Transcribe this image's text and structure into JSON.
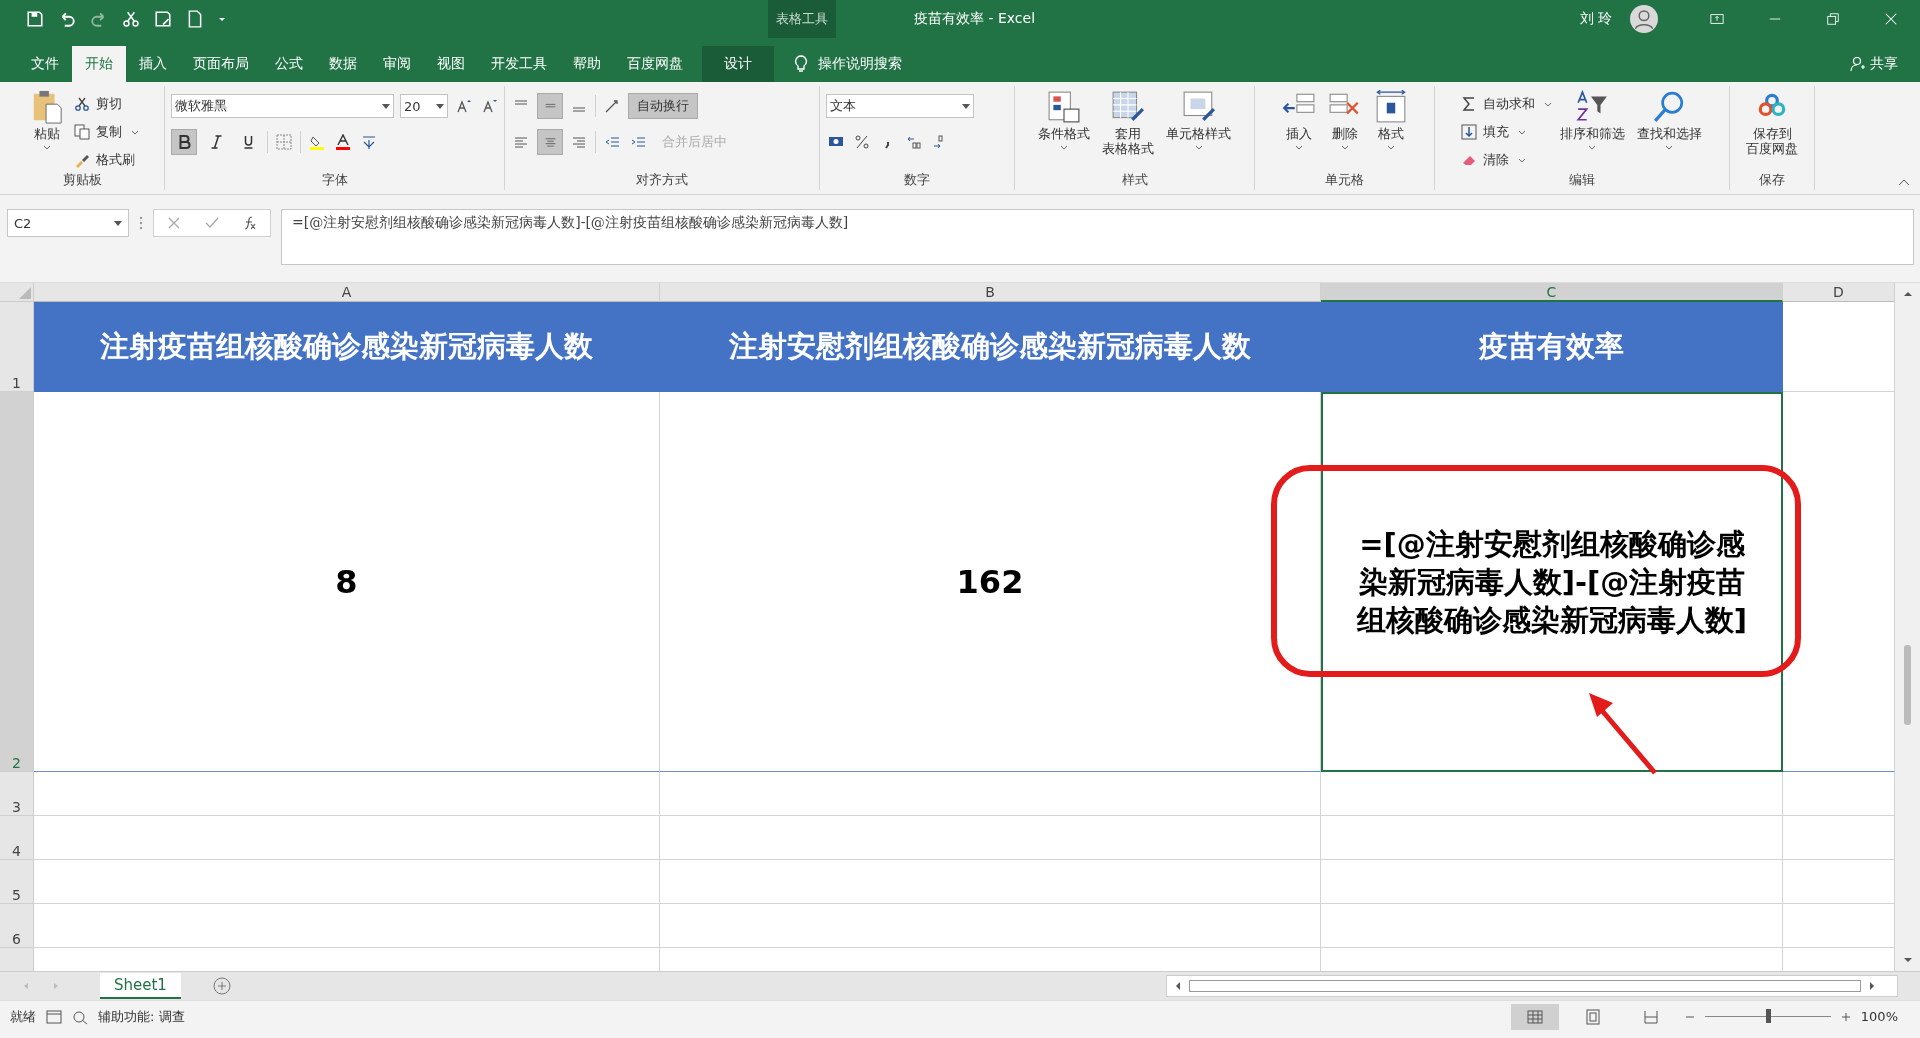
{
  "window": {
    "context_label": "表格工具",
    "title": "疫苗有效率 - Excel",
    "user": "刘 玲"
  },
  "tabs": [
    {
      "label": "文件",
      "selected": false,
      "kind": "normal"
    },
    {
      "label": "开始",
      "selected": true,
      "kind": "normal"
    },
    {
      "label": "插入",
      "selected": false,
      "kind": "normal"
    },
    {
      "label": "页面布局",
      "selected": false,
      "kind": "normal"
    },
    {
      "label": "公式",
      "selected": false,
      "kind": "normal"
    },
    {
      "label": "数据",
      "selected": false,
      "kind": "normal"
    },
    {
      "label": "审阅",
      "selected": false,
      "kind": "normal"
    },
    {
      "label": "视图",
      "selected": false,
      "kind": "normal"
    },
    {
      "label": "开发工具",
      "selected": false,
      "kind": "normal"
    },
    {
      "label": "帮助",
      "selected": false,
      "kind": "normal"
    },
    {
      "label": "百度网盘",
      "selected": false,
      "kind": "normal"
    },
    {
      "label": "设计",
      "selected": false,
      "kind": "contextual"
    }
  ],
  "tell_me": "操作说明搜索",
  "share": "共享",
  "clipboard": {
    "label": "剪贴板",
    "paste": "粘贴",
    "cut": "剪切",
    "copy": "复制",
    "painter": "格式刷"
  },
  "font": {
    "label": "字体",
    "name": "微软雅黑",
    "size": "20",
    "bold": true,
    "italic": false,
    "underline": false
  },
  "alignment": {
    "label": "对齐方式",
    "wrap": "自动换行",
    "wrap_on": true,
    "merge": "合并后居中",
    "merge_disabled": true,
    "center": true
  },
  "number": {
    "label": "数字",
    "format": "文本"
  },
  "styles": {
    "label": "样式",
    "conditional": "条件格式",
    "table_1": "套用",
    "table_2": "表格格式",
    "cell_styles": "单元格样式"
  },
  "cells": {
    "label": "单元格",
    "insert": "插入",
    "delete": "删除",
    "format": "格式"
  },
  "editing": {
    "label": "编辑",
    "autosum": "自动求和",
    "fill": "填充",
    "clear": "清除",
    "sort": "排序和筛选",
    "find": "查找和选择"
  },
  "save": {
    "label": "保存",
    "line_1": "保存到",
    "line_2": "百度网盘"
  },
  "formula_bar": {
    "name_box": "C2",
    "formula": "=[@注射安慰剂组核酸确诊感染新冠病毒人数]-[@注射疫苗组核酸确诊感染新冠病毒人数]"
  },
  "columns": [
    {
      "label": "A",
      "selected": false
    },
    {
      "label": "B",
      "selected": false
    },
    {
      "label": "C",
      "selected": true
    },
    {
      "label": "D",
      "selected": false
    }
  ],
  "rows": [
    {
      "label": "1",
      "selected": false,
      "kind": "header",
      "cells": [
        "注射疫苗组核酸确诊感染新冠病毒人数",
        "注射安慰剂组核酸确诊感染新冠病毒人数",
        "疫苗有效率"
      ]
    },
    {
      "label": "2",
      "selected": true,
      "kind": "data",
      "cells": [
        "8",
        "162",
        "=[@注射安慰剂组核酸确诊感染新冠病毒人数]-[@注射疫苗组核酸确诊感染新冠病毒人数]"
      ]
    },
    {
      "label": "3",
      "selected": false,
      "kind": "empty",
      "cells": []
    },
    {
      "label": "4",
      "selected": false,
      "kind": "empty",
      "cells": []
    },
    {
      "label": "5",
      "selected": false,
      "kind": "empty",
      "cells": []
    },
    {
      "label": "6",
      "selected": false,
      "kind": "empty",
      "cells": []
    }
  ],
  "sheets": [
    {
      "name": "Sheet1",
      "selected": true
    }
  ],
  "status_bar": {
    "ready": "就绪",
    "accessibility": "辅助功能: 调查",
    "zoom": "100%",
    "zoom_slider": {
      "level": 0.5
    },
    "views": [
      {
        "kind": "normal",
        "selected": true
      },
      {
        "kind": "layout",
        "selected": false
      },
      {
        "kind": "break",
        "selected": false
      }
    ]
  }
}
